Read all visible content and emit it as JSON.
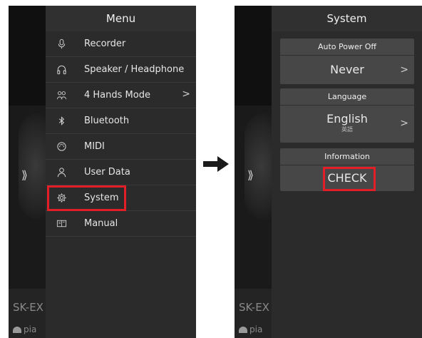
{
  "left_screen": {
    "title": "Menu",
    "items": [
      {
        "label": "Recorder",
        "icon": "microphone-icon"
      },
      {
        "label": "Speaker / Headphone",
        "icon": "headphone-icon"
      },
      {
        "label": "4 Hands Mode",
        "icon": "four-hands-icon",
        "chevron": ">"
      },
      {
        "label": "Bluetooth",
        "icon": "bluetooth-icon"
      },
      {
        "label": "MIDI",
        "icon": "midi-icon"
      },
      {
        "label": "User Data",
        "icon": "user-icon"
      },
      {
        "label": "System",
        "icon": "gear-icon"
      },
      {
        "label": "Manual",
        "icon": "book-icon"
      }
    ]
  },
  "right_screen": {
    "title": "System",
    "auto_power_off": {
      "label": "Auto Power Off",
      "value": "Never",
      "chevron": ">"
    },
    "language": {
      "label": "Language",
      "value": "English",
      "sub": "英語",
      "chevron": ">"
    },
    "information": {
      "label": "Information",
      "button": "CHECK"
    }
  },
  "background": {
    "chevron": "⟫",
    "model_text": "SK-EX",
    "piano_text": "pia"
  },
  "colors": {
    "highlight": "#e21f26",
    "panel": "#2b2b2b",
    "group": "#474747"
  }
}
